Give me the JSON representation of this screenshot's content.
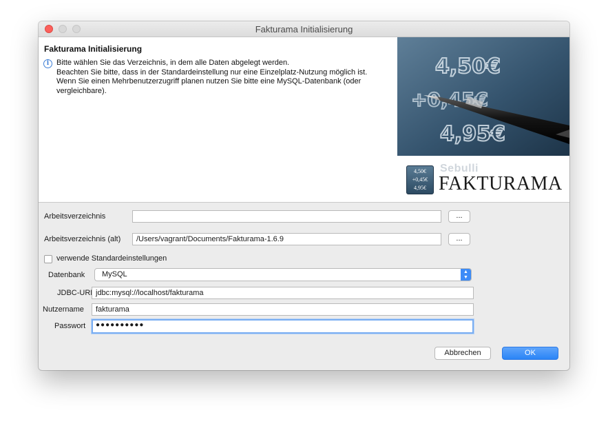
{
  "window": {
    "title": "Fakturama Initialisierung"
  },
  "header": {
    "title": "Fakturama Initialisierung",
    "info_icon": "info-icon",
    "message_lines": [
      " Bitte wählen Sie das Verzeichnis, in dem alle Daten abgelegt werden.",
      "Beachten Sie bitte, dass in der Standardeinstellung nur eine Einzelplatz-Nutzung möglich ist.",
      "Wenn Sie einen Mehrbenutzerzugriff planen nutzen Sie bitte eine MySQL-Datenbank (oder",
      "vergleichbare)."
    ],
    "banner": {
      "photo_numbers": [
        "4,50€",
        "+0,45€",
        "4,95€"
      ],
      "logo_tile_lines": [
        "4,50€",
        "+0,45€",
        "4,95€"
      ],
      "logo_small": "Sebulli",
      "logo_big": "FAKTURAMA"
    }
  },
  "form": {
    "workdir": {
      "label": "Arbeitsverzeichnis",
      "value": "",
      "browse_label": "..."
    },
    "workdir_old": {
      "label": "Arbeitsverzeichnis (alt)",
      "value": "/Users/vagrant/Documents/Fakturama-1.6.9",
      "browse_label": "..."
    },
    "use_defaults": {
      "label": "verwende Standardeinstellungen",
      "checked": false
    },
    "database": {
      "label": "Datenbank",
      "value": "MySQL",
      "arrow_icon": "chevron-updown-icon"
    },
    "jdbc_url": {
      "label": "JDBC-URL",
      "value": "jdbc:mysql://localhost/fakturama"
    },
    "username": {
      "label": "Nutzername",
      "value": "fakturama"
    },
    "password": {
      "label": "Passwort",
      "value": "●●●●●●●●●●"
    }
  },
  "buttons": {
    "cancel": "Abbrechen",
    "ok": "OK"
  },
  "colors": {
    "accent": "#3c8bf7",
    "close": "#fc605c",
    "focus_ring": "#7aaef2"
  }
}
